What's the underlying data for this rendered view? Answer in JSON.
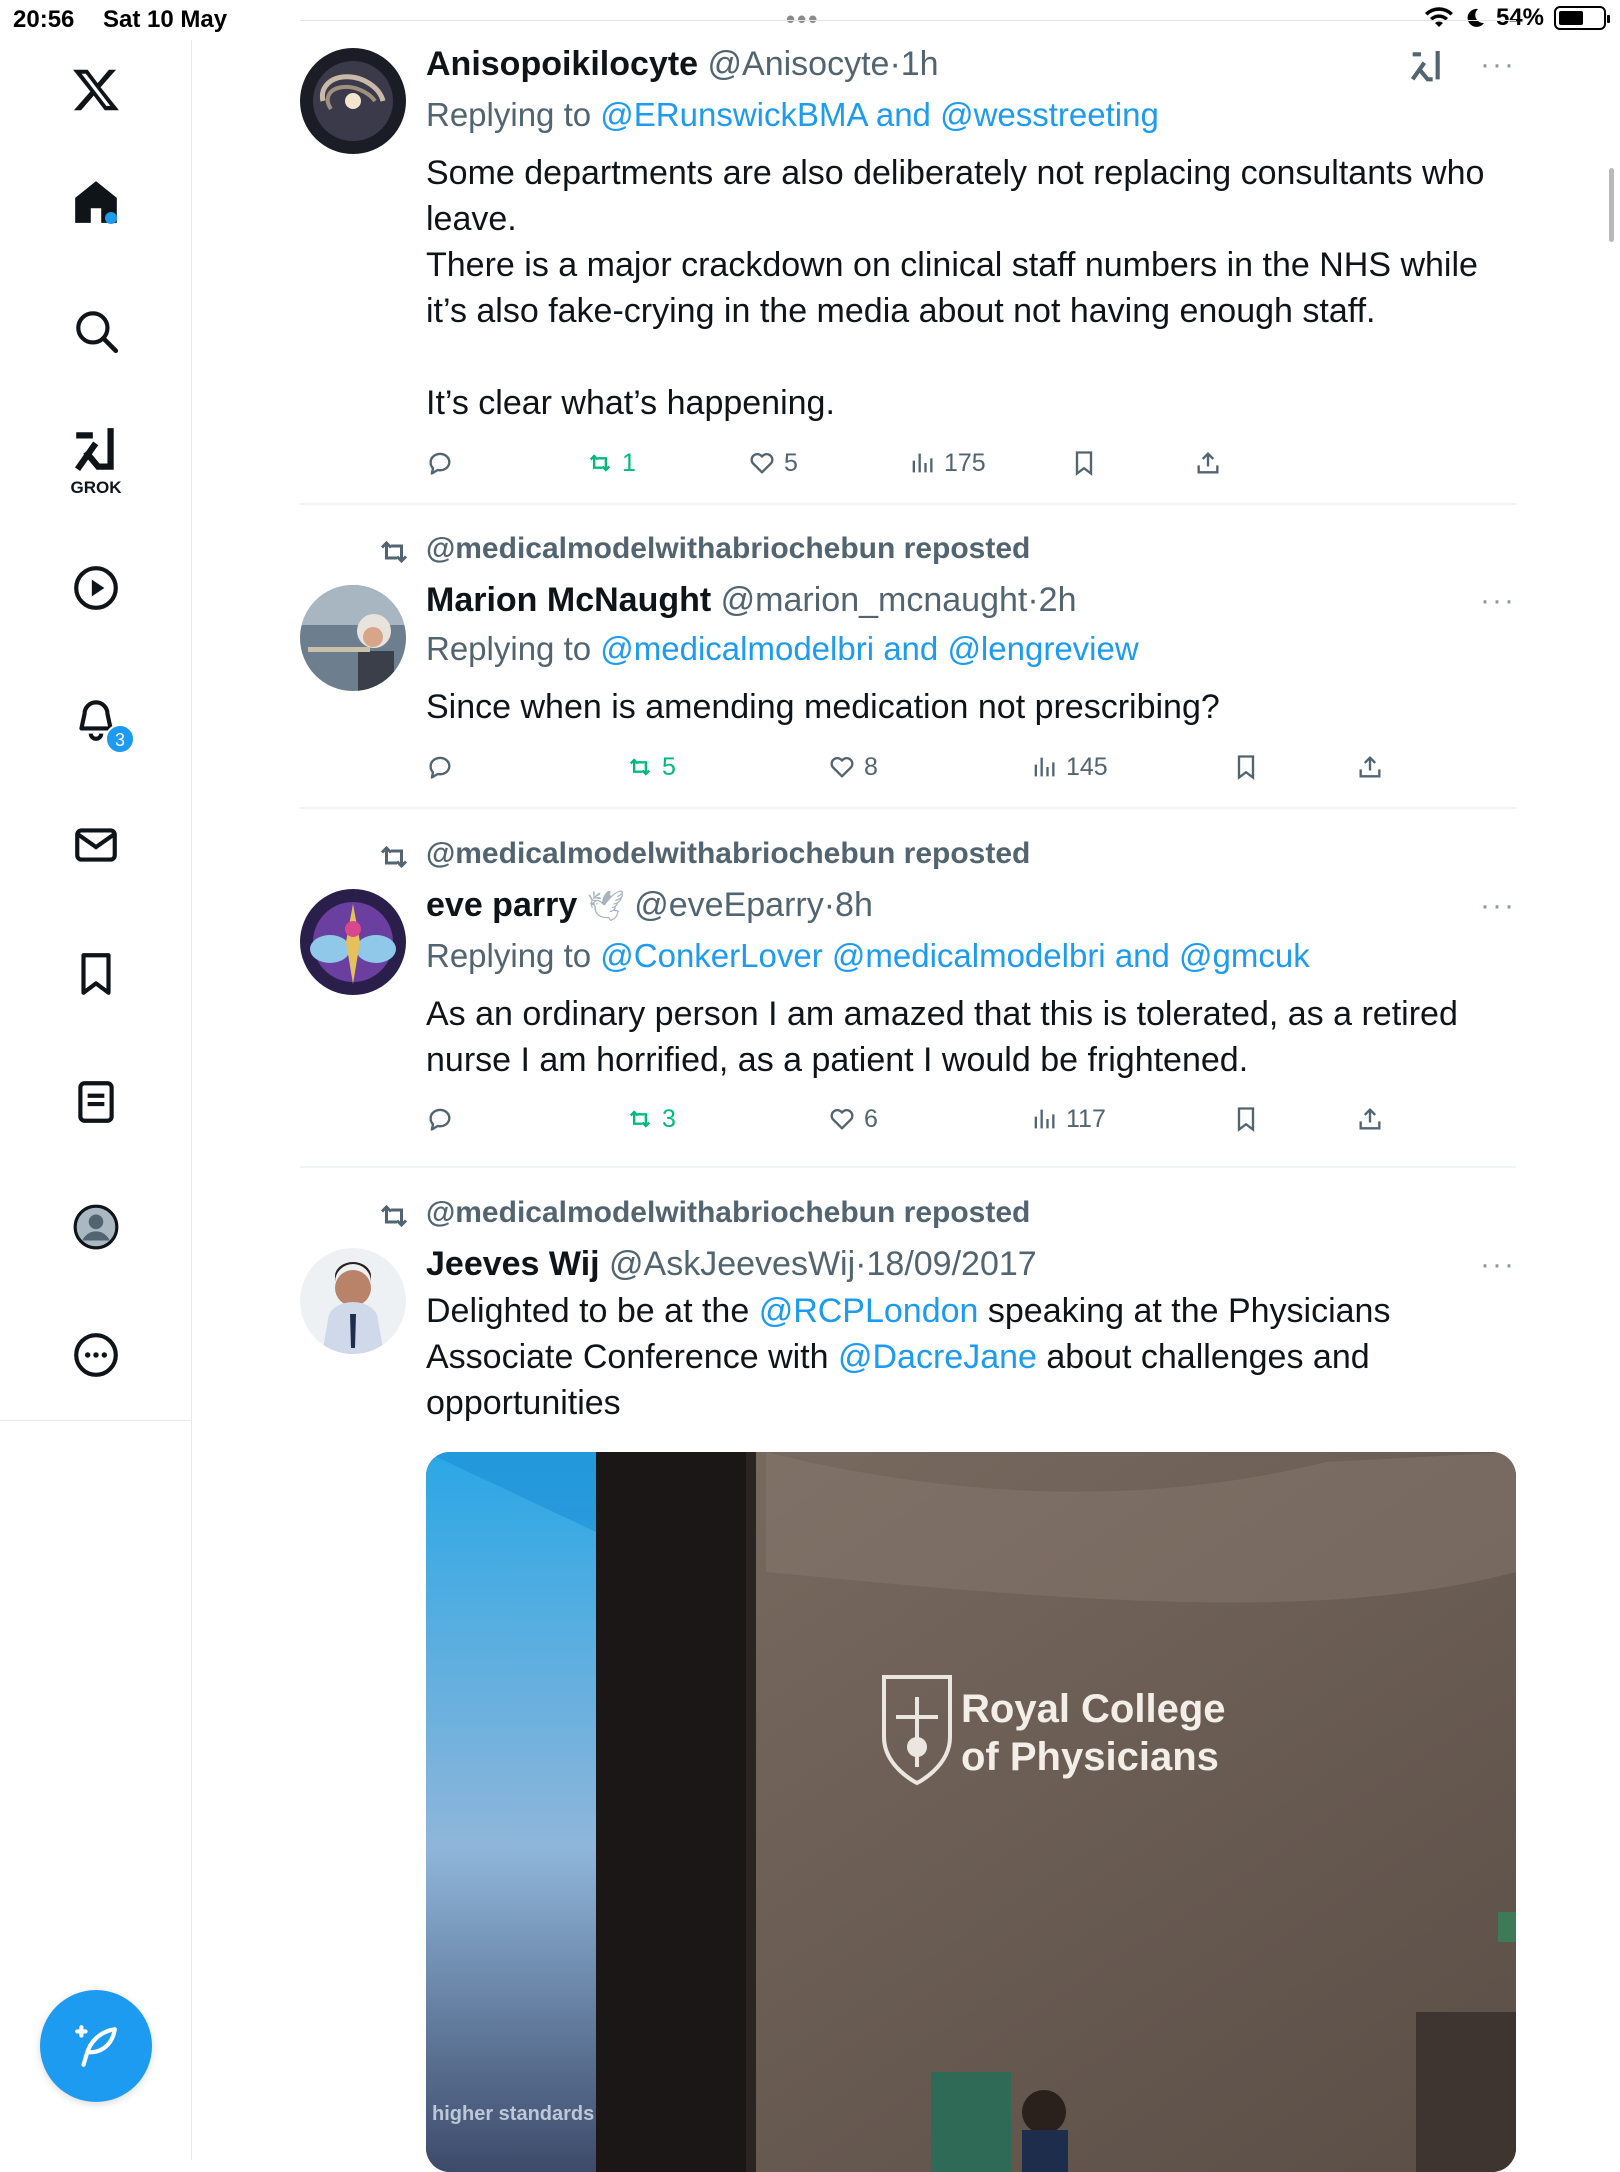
{
  "status_bar": {
    "time": "20:56",
    "date": "Sat 10 May",
    "battery": "54%",
    "battery_level": 0.54
  },
  "sidebar": {
    "grok_label": "GROK",
    "notifications_badge": "3",
    "icons": [
      "x-logo-icon",
      "home-icon",
      "search-icon",
      "grok-icon",
      "video-icon",
      "bell-icon",
      "mail-icon",
      "bookmark-icon",
      "lists-icon",
      "profile-icon",
      "more-icon"
    ]
  },
  "tweets": [
    {
      "name": "Anisopoikilocyte",
      "handle": "@Anisocyte",
      "time": "1h",
      "replying_label": "Replying to ",
      "replying_to": [
        "@ERunswickBMA",
        "@wesstreeting"
      ],
      "text": "Some departments are also deliberately not replacing consultants who leave.\nThere is a major crackdown on clinical staff numbers in the NHS while it’s also fake-crying in the media about not having enough staff.\n\nIt’s clear what’s happening.",
      "replies": "",
      "reposts": "1",
      "likes": "5",
      "views": "175"
    },
    {
      "reposted_by": "@medicalmodelwithabriochebun reposted",
      "name": "Marion McNaught",
      "handle": "@marion_mcnaught",
      "time": "2h",
      "replying_label": "Replying to ",
      "replying_to": [
        "@medicalmodelbri",
        "@lengreview"
      ],
      "text": "Since when is amending medication not prescribing?",
      "replies": "",
      "reposts": "5",
      "likes": "8",
      "views": "145"
    },
    {
      "reposted_by": "@medicalmodelwithabriochebun reposted",
      "name": "eve parry",
      "name_emoji": "🕊",
      "handle": "@eveEparry",
      "time": "8h",
      "replying_label": "Replying to ",
      "replying_to": [
        "@ConkerLover",
        "@medicalmodelbri",
        "@gmcuk"
      ],
      "text": "As an ordinary person I am amazed that this is tolerated, as a retired nurse I am horrified, as a patient I would be frightened.",
      "replies": "",
      "reposts": "3",
      "likes": "6",
      "views": "117"
    },
    {
      "reposted_by": "@medicalmodelwithabriochebun reposted",
      "name": "Jeeves Wij",
      "handle": "@AskJeevesWij",
      "time": "18/09/2017",
      "text_parts": {
        "a": "Delighted to be at the ",
        "link1": "@RCPLondon",
        "b": " speaking at the Physicians Associate Conference with ",
        "link2": "@DacreJane",
        "c": " about challenges and opportunities"
      },
      "media": {
        "logo_line1": "Royal College",
        "logo_line2": "of Physicians",
        "screen_caption": "higher standards"
      }
    }
  ],
  "connectors": {
    "and": "and",
    "dot": "·"
  },
  "colors": {
    "accent": "#1d9bf0",
    "repost_green": "#00ba7c",
    "muted": "#536471"
  }
}
